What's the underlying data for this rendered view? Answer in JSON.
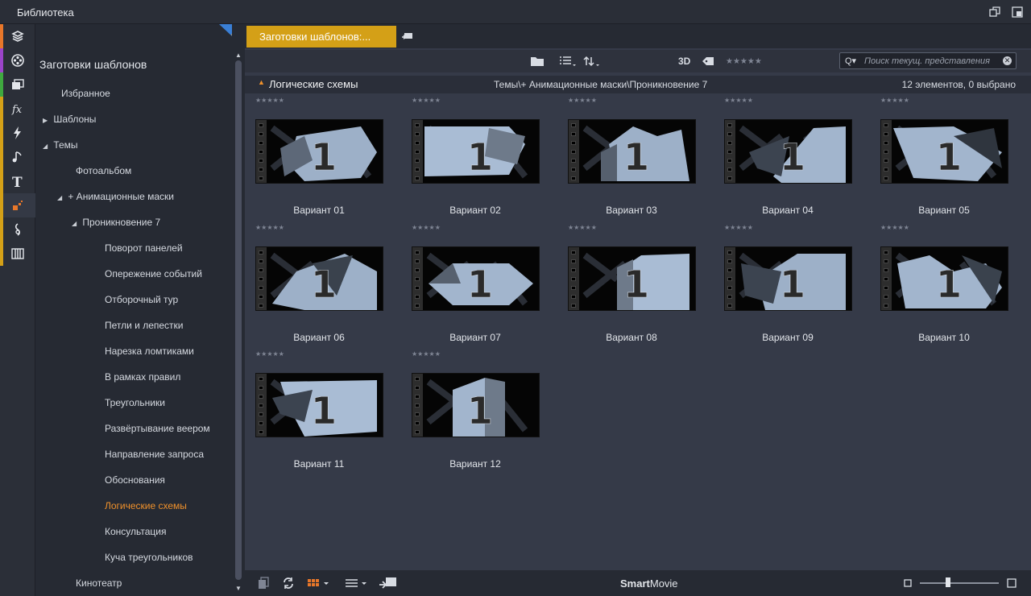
{
  "window": {
    "title": "Библиотека",
    "restore_icon": "restore-icon",
    "detach_icon": "detach-icon"
  },
  "iconbar": {
    "items": [
      {
        "name": "project-bins-icon",
        "color": "#e8772a"
      },
      {
        "name": "film-reel-icon",
        "color": "#9b44c9"
      },
      {
        "name": "photo-collection-icon",
        "color": "#3fa93f"
      },
      {
        "name": "effects-icon",
        "color": "#d4a017"
      },
      {
        "name": "transitions-icon",
        "color": "#d4a017"
      },
      {
        "name": "music-icon",
        "color": "#d4a017"
      },
      {
        "name": "titles-icon",
        "color": "#d4a017"
      },
      {
        "name": "templates-icon",
        "color": "#d4a017"
      },
      {
        "name": "sound-effects-icon",
        "color": "#d4a017"
      },
      {
        "name": "scoring-icon",
        "color": "#d4a017"
      }
    ]
  },
  "tree": {
    "root": "Заготовки шаблонов",
    "nodes": [
      {
        "label": "Избранное",
        "arrow": ""
      },
      {
        "label": "Шаблоны",
        "arrow": "▶"
      },
      {
        "label": "Темы",
        "arrow": "◢"
      },
      {
        "label": "Фотоальбом",
        "arrow": ""
      },
      {
        "label": "+ Анимационные маски",
        "arrow": "◢"
      },
      {
        "label": "Проникновение 7",
        "arrow": "◢"
      },
      {
        "label": "Поворот панелей",
        "arrow": ""
      },
      {
        "label": "Опережение событий",
        "arrow": ""
      },
      {
        "label": "Отборочный тур",
        "arrow": ""
      },
      {
        "label": "Петли и лепестки",
        "arrow": ""
      },
      {
        "label": "Нарезка ломтиками",
        "arrow": ""
      },
      {
        "label": "В рамках правил",
        "arrow": ""
      },
      {
        "label": "Треугольники",
        "arrow": ""
      },
      {
        "label": "Развёртывание веером",
        "arrow": ""
      },
      {
        "label": "Направление запроса",
        "arrow": ""
      },
      {
        "label": "Обоснования",
        "arrow": ""
      },
      {
        "label": "Логические схемы",
        "arrow": ""
      },
      {
        "label": "Консультация",
        "arrow": ""
      },
      {
        "label": "Куча треугольников",
        "arrow": ""
      },
      {
        "label": "Кинотеатр",
        "arrow": ""
      }
    ]
  },
  "tab": {
    "label": "Заготовки шаблонов:..."
  },
  "toolbar": {
    "three_d": "3D",
    "rating_stars": "★★★★★",
    "search_icon": "Q▾",
    "search_placeholder": "Поиск текущ. представления",
    "clear": "✕"
  },
  "collection": {
    "name": "Логические схемы",
    "path": "Темы\\+ Анимационные маски\\Проникновение 7",
    "count": "12 элементов, 0 выбрано"
  },
  "items": [
    {
      "label": "Вариант 01",
      "stars": "★★★★★",
      "digit": "1"
    },
    {
      "label": "Вариант 02",
      "stars": "★★★★★",
      "digit": "1"
    },
    {
      "label": "Вариант 03",
      "stars": "★★★★★",
      "digit": "1"
    },
    {
      "label": "Вариант 04",
      "stars": "★★★★★",
      "digit": "1"
    },
    {
      "label": "Вариант 05",
      "stars": "★★★★★",
      "digit": "1"
    },
    {
      "label": "Вариант 06",
      "stars": "★★★★★",
      "digit": "1"
    },
    {
      "label": "Вариант 07",
      "stars": "★★★★★",
      "digit": "1"
    },
    {
      "label": "Вариант 08",
      "stars": "★★★★★",
      "digit": "1"
    },
    {
      "label": "Вариант 09",
      "stars": "★★★★★",
      "digit": "1"
    },
    {
      "label": "Вариант 10",
      "stars": "★★★★★",
      "digit": "1"
    },
    {
      "label": "Вариант 11",
      "stars": "★★★★★",
      "digit": "1"
    },
    {
      "label": "Вариант 12",
      "stars": "★★★★★",
      "digit": "1"
    }
  ],
  "bottombar": {
    "logo_bold": "Smart",
    "logo_rest": "Movie"
  },
  "zoom_level": 0.35
}
